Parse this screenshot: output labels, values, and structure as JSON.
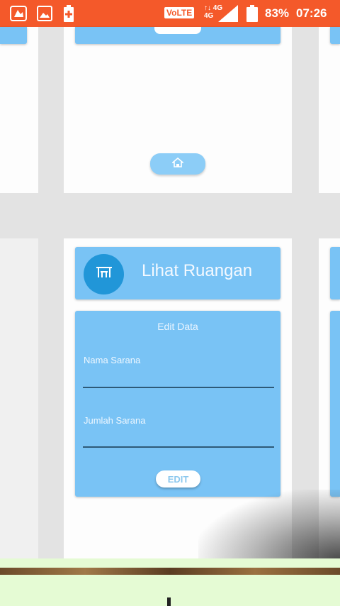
{
  "status_bar": {
    "battery_percent": "83%",
    "time": "07:26",
    "volte_label": "VoLTE",
    "network_type": "4G",
    "icons": [
      "drive-notification-icon",
      "gallery-notification-icon",
      "battery-saver-icon",
      "signal-icon",
      "battery-icon"
    ]
  },
  "header_card": {
    "title": "Lihat Ruangan",
    "icon": "room-icon"
  },
  "form": {
    "title": "Edit Data",
    "field_1_label": "Nama Sarana",
    "field_2_label": "Jumlah Sarana",
    "submit_label": "EDIT"
  },
  "top_card": {
    "button_icon": "home-icon"
  },
  "colors": {
    "status_bar": "#f4592a",
    "panel_blue": "#79c3f5",
    "avatar_blue": "#2196d8",
    "background": "#e3e3e3"
  }
}
